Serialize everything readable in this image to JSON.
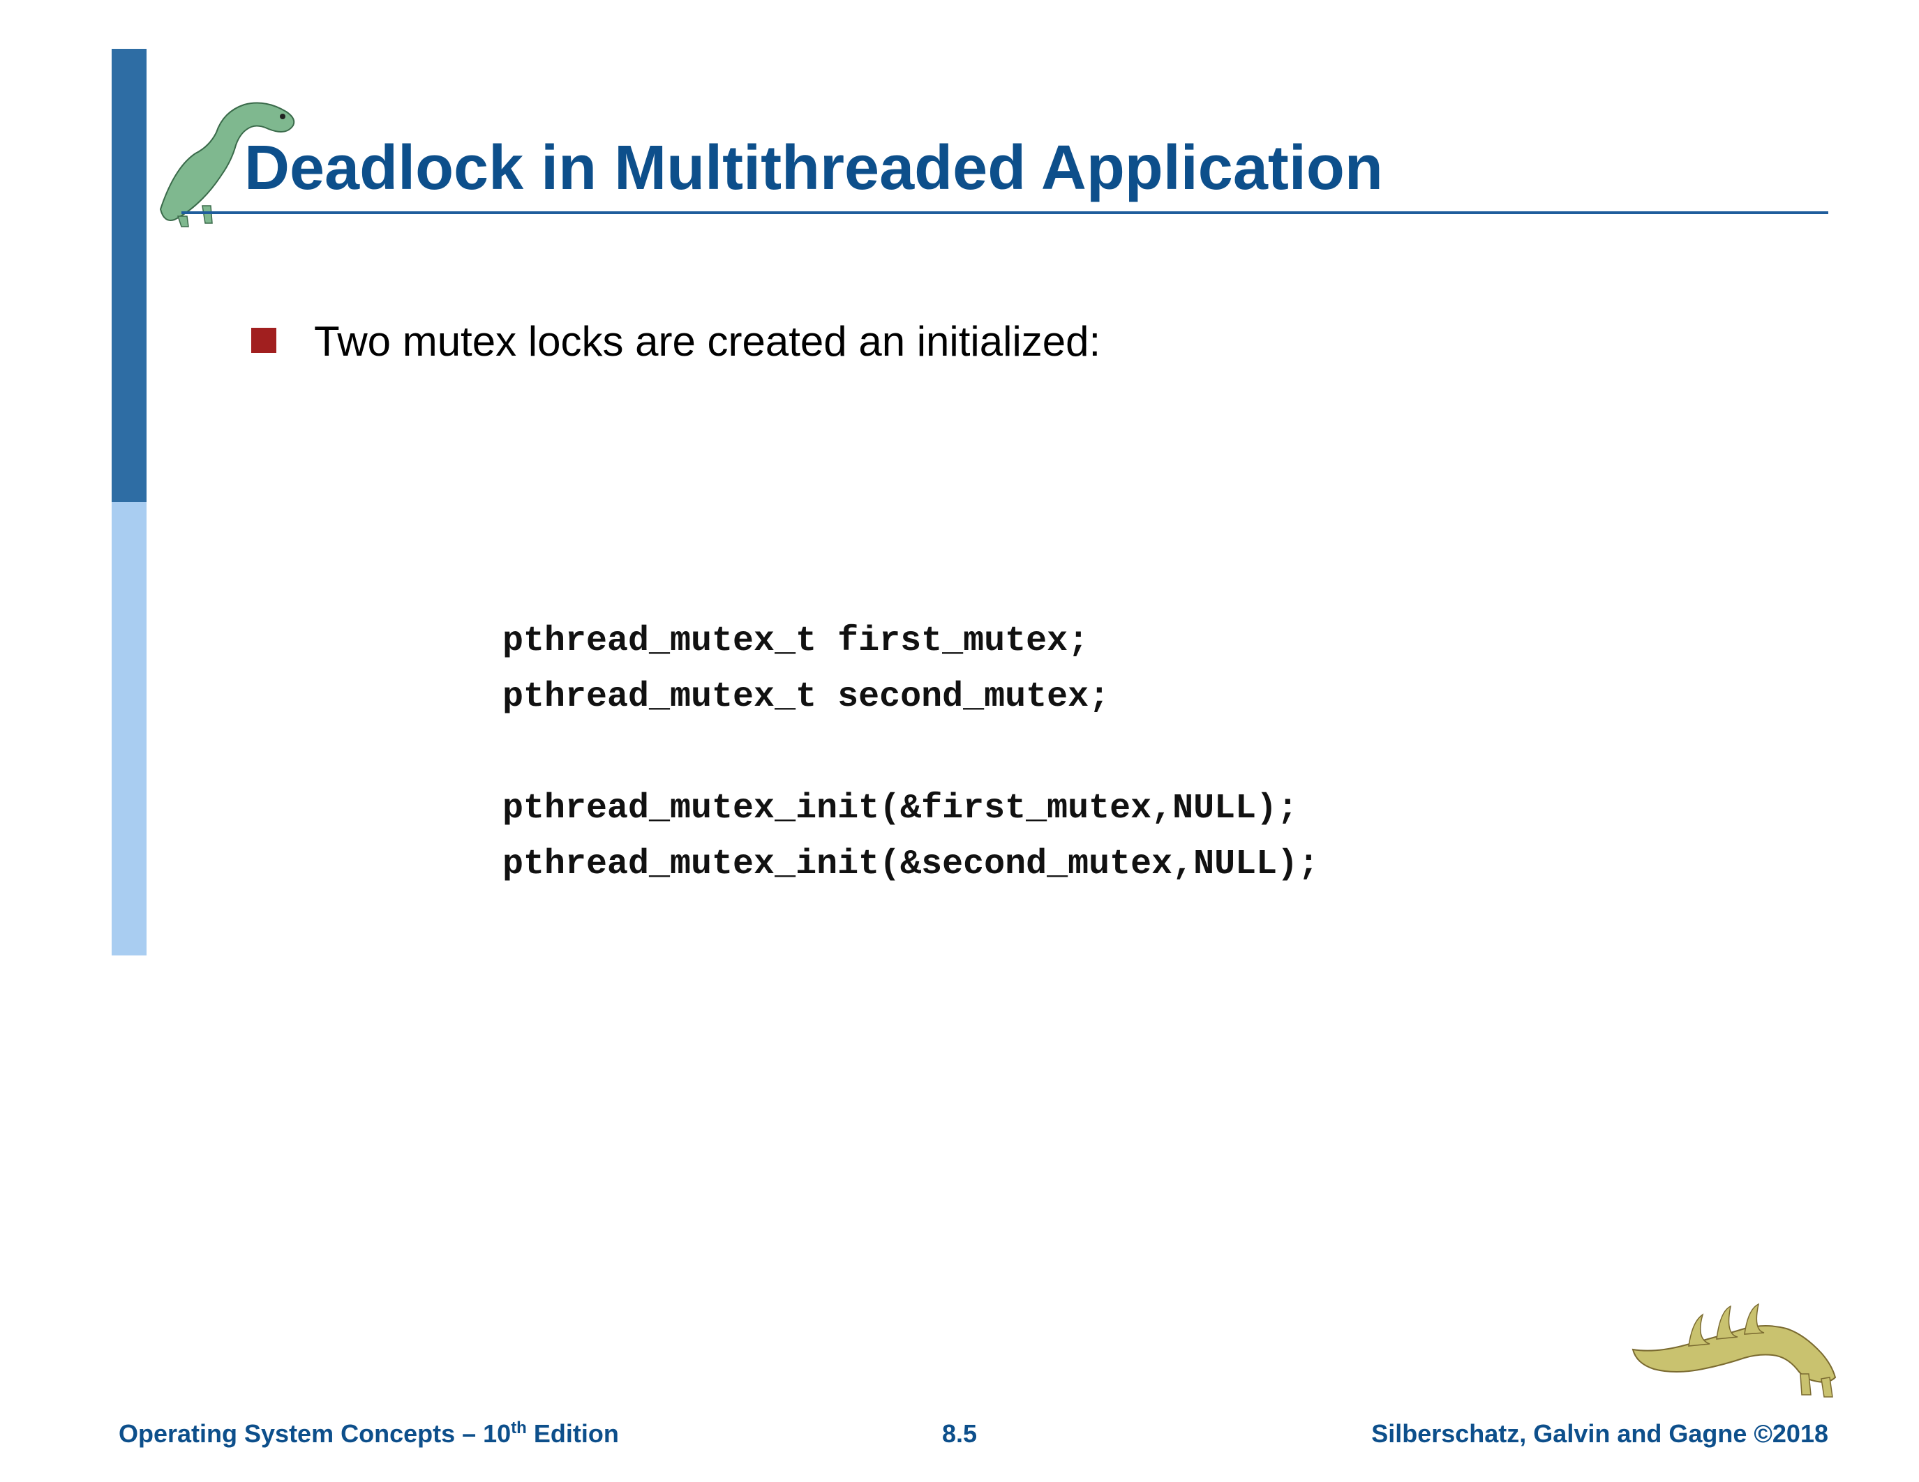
{
  "title": "Deadlock in Multithreaded Application",
  "bullet1": "Two mutex locks are created an initialized:",
  "code": "pthread_mutex_t first_mutex;\npthread_mutex_t second_mutex;\n\npthread_mutex_init(&first_mutex,NULL);\npthread_mutex_init(&second_mutex,NULL);",
  "footer": {
    "left_prefix": "Operating System Concepts – 10",
    "left_suffix": " Edition",
    "left_sup": "th",
    "center": "8.5",
    "right": "Silberschatz, Galvin and Gagne ©2018"
  }
}
